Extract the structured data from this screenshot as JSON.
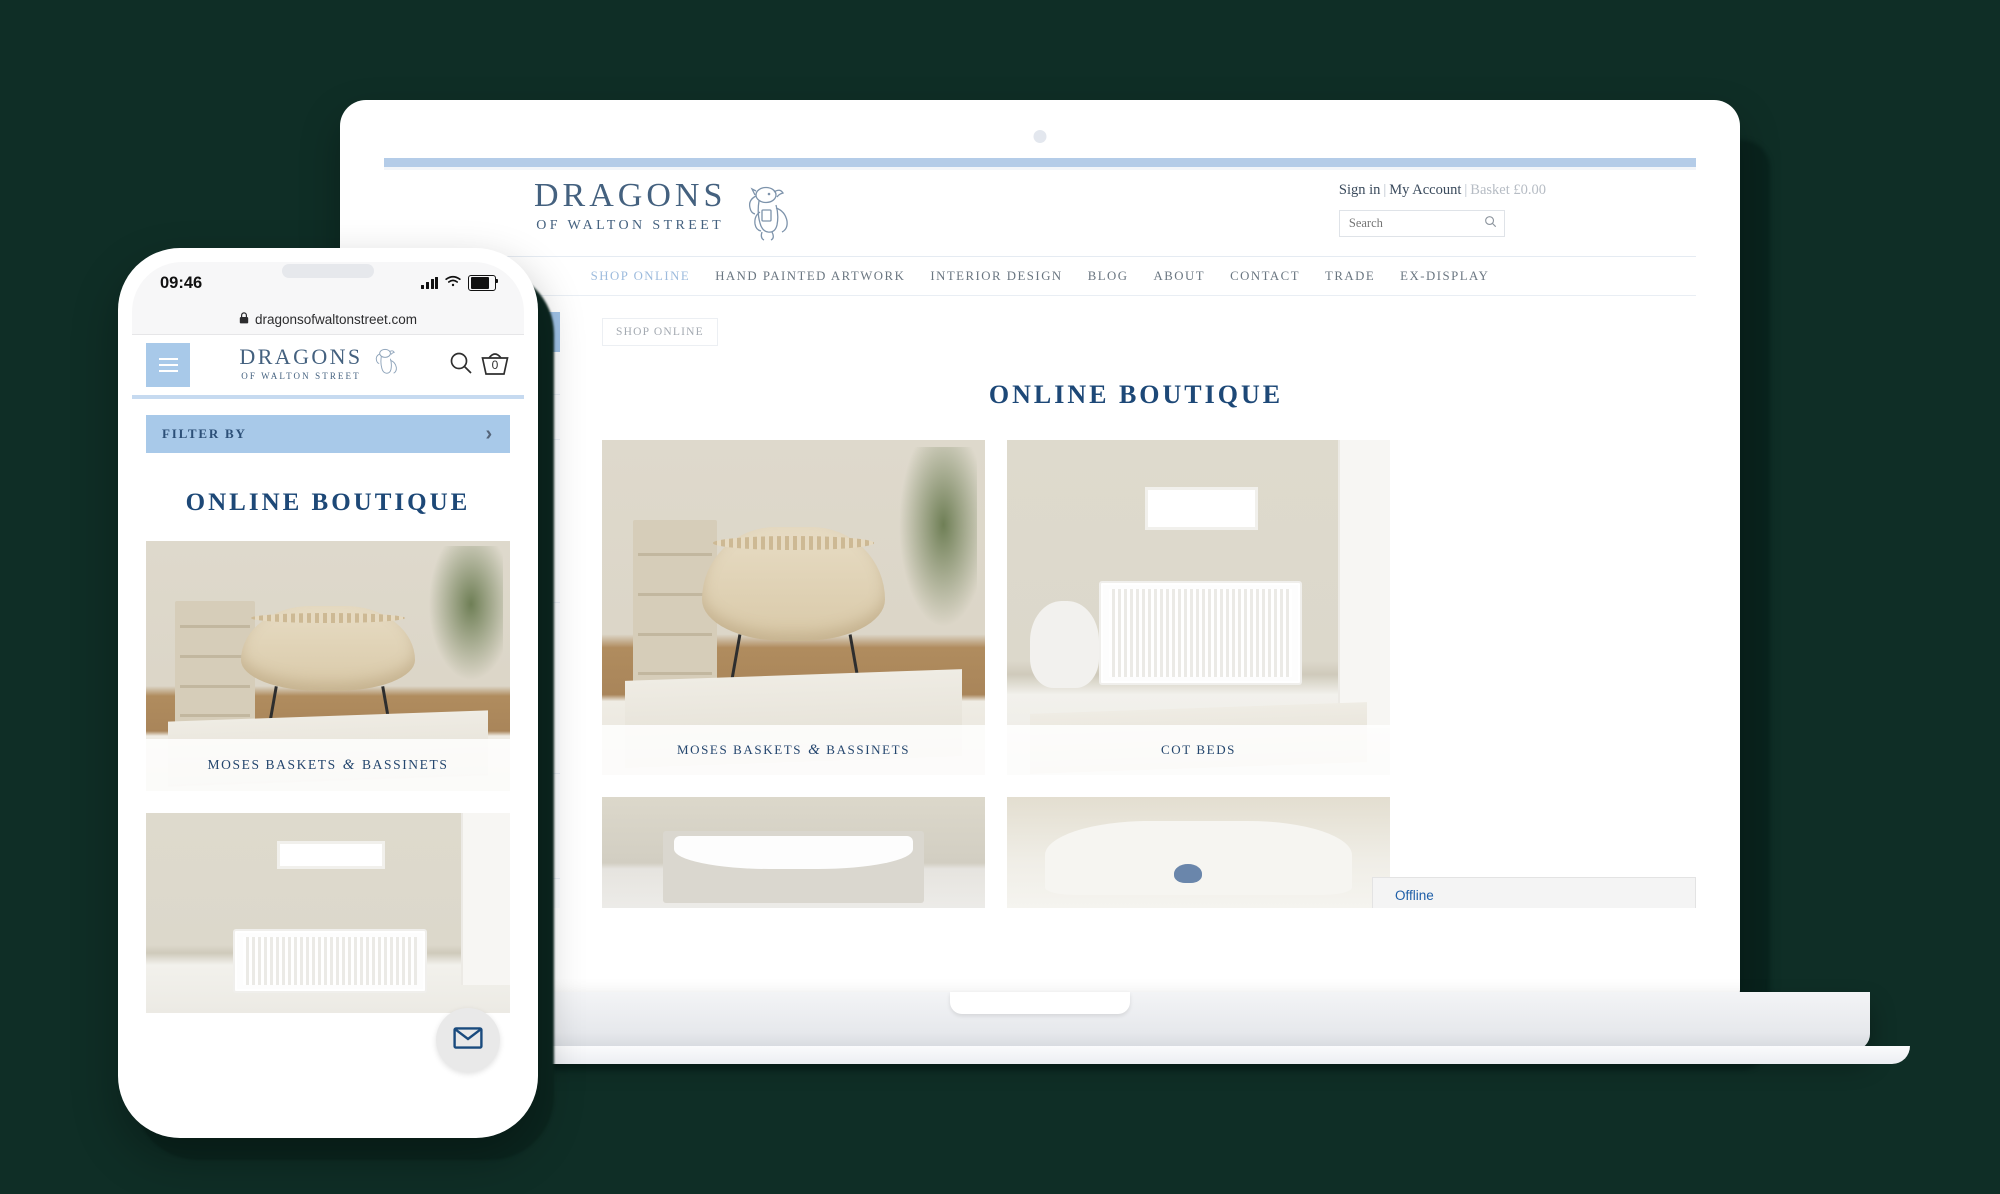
{
  "colors": {
    "background": "#0f2e26",
    "brand_navy": "#1d4877",
    "logo_blue": "#44617f",
    "accent_light_blue": "#a8c9e9",
    "nav_active": "#9dbbdd",
    "chat_link": "#1f5fa8"
  },
  "desktop": {
    "brand": {
      "name": "DRAGONS",
      "tagline": "OF WALTON STREET",
      "mascot": "dragon-painter-logo"
    },
    "account": {
      "sign_in": "Sign in",
      "separator": "|",
      "my_account": "My Account",
      "basket": "Basket £0.00"
    },
    "search": {
      "placeholder": "Search",
      "value": ""
    },
    "nav": [
      {
        "label": "SHOP ONLINE",
        "active": true
      },
      {
        "label": "HAND PAINTED ARTWORK",
        "active": false
      },
      {
        "label": "INTERIOR DESIGN",
        "active": false
      },
      {
        "label": "BLOG",
        "active": false
      },
      {
        "label": "ABOUT",
        "active": false
      },
      {
        "label": "CONTACT",
        "active": false
      },
      {
        "label": "TRADE",
        "active": false
      },
      {
        "label": "EX-DISPLAY",
        "active": false
      }
    ],
    "breadcrumb": "SHOP ONLINE",
    "page_title": "ONLINE BOUTIQUE",
    "sidebar": {
      "filter_header": "FILTER BY",
      "rows": [
        {
          "state": "collapsed",
          "icon": "chevron-right-icon"
        },
        {
          "state": "collapsed",
          "icon": "chevron-right-icon"
        },
        {
          "state": "expanded",
          "icon": "chevron-down-icon"
        },
        {
          "state": "expanded",
          "icon": "chevron-down-icon"
        },
        {
          "state": "expanded",
          "icon": "chevron-down-icon"
        },
        {
          "state": "collapsed",
          "icon": "chevron-right-icon"
        },
        {
          "state": "collapsed",
          "icon": "chevron-right-icon"
        }
      ]
    },
    "products": [
      {
        "caption_before": "MOSES BASKETS",
        "caption_amp": "&",
        "caption_after": "BASSINETS",
        "photo": "moses-basket-nursery"
      },
      {
        "caption_before": "COT BEDS",
        "caption_amp": "",
        "caption_after": "",
        "photo": "white-cot-bed-nursery"
      },
      {
        "caption_before": "",
        "caption_amp": "",
        "caption_after": "",
        "photo": "changing-mat"
      },
      {
        "caption_before": "",
        "caption_amp": "",
        "caption_after": "",
        "photo": "nursery-furniture"
      }
    ],
    "chat": {
      "status": "Offline"
    }
  },
  "mobile": {
    "status_bar": {
      "time": "09:46",
      "signal": "signal-bars-icon",
      "wifi": "wifi-icon",
      "battery": "battery-icon"
    },
    "url_bar": {
      "lock": "lock-icon",
      "url": "dragonsofwaltonstreet.com"
    },
    "header": {
      "menu": "hamburger-menu-icon",
      "brand_name": "DRAGONS",
      "brand_tagline": "OF WALTON STREET",
      "search": "search-icon",
      "basket": "basket-icon",
      "basket_count": "0"
    },
    "filter": {
      "label": "FILTER BY",
      "icon": "chevron-right-icon"
    },
    "page_title": "ONLINE BOUTIQUE",
    "products": [
      {
        "caption_before": "MOSES BASKETS",
        "caption_amp": "&",
        "caption_after": "BASSINETS",
        "photo": "moses-basket-nursery"
      },
      {
        "caption_before": "",
        "caption_amp": "",
        "caption_after": "",
        "photo": "white-cot-bed-nursery"
      }
    ],
    "mail_button": {
      "icon": "envelope-icon"
    }
  }
}
